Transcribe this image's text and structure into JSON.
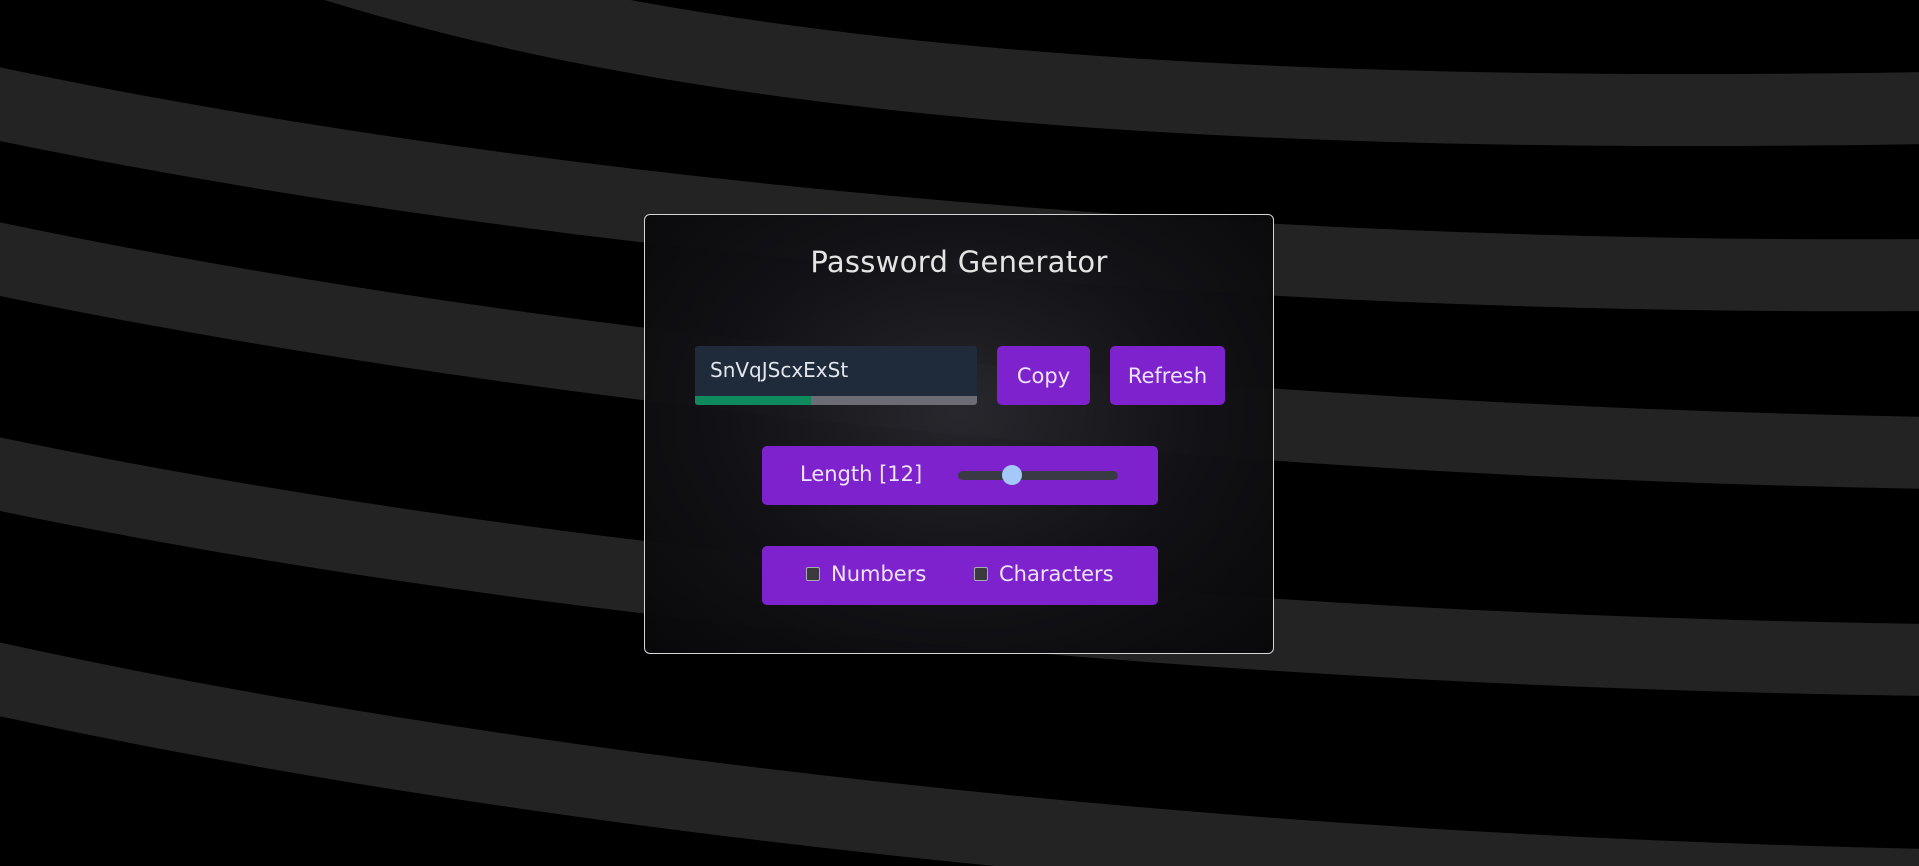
{
  "app": {
    "title": "Password Generator"
  },
  "password": {
    "value": "SnVqJScxExSt",
    "strength_fraction": 0.41,
    "strength_color": "#0f8a5f"
  },
  "actions": {
    "copy_label": "Copy",
    "refresh_label": "Refresh"
  },
  "length": {
    "label": "Length [12]",
    "value": 12,
    "slider_fraction": 0.34
  },
  "options": {
    "numbers_label": "Numbers",
    "numbers_checked": false,
    "characters_label": "Characters",
    "characters_checked": false
  },
  "colors": {
    "accent": "#7e22ce",
    "background": "#000000",
    "stripe": "#232323",
    "slider_thumb": "#a5c8fb"
  }
}
